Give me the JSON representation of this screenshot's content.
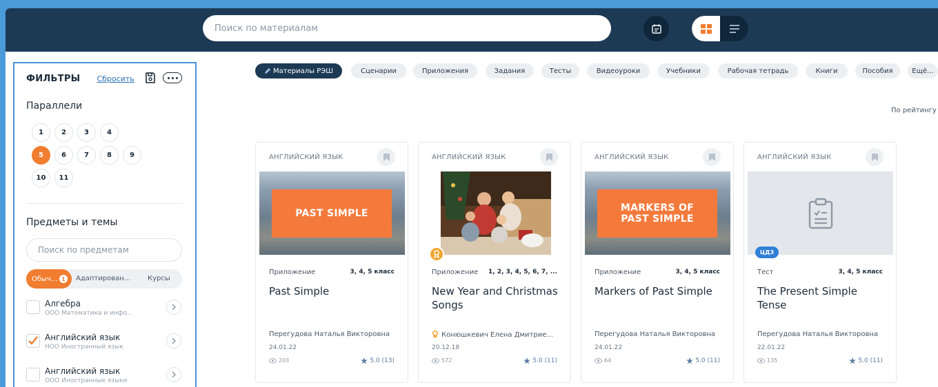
{
  "search": {
    "placeholder": "Поиск по материалам"
  },
  "icons": {
    "calendar": "calendar-icon",
    "grid_view": "grid-view-icon",
    "list_view": "list-view-icon",
    "save": "save-icon",
    "more": "more-icon",
    "bookmark": "bookmark-icon",
    "views": "views-icon",
    "star": "star-icon"
  },
  "colors": {
    "header": "#1d3a55",
    "accent": "#f07d30",
    "link": "#2a6fb3",
    "frame": "#4a9bd8"
  },
  "filters": {
    "title": "ФИЛЬТРЫ",
    "reset": "Сбросить",
    "grades_title": "Параллели",
    "grades": [
      "1",
      "2",
      "3",
      "4",
      "5",
      "6",
      "7",
      "8",
      "9",
      "10",
      "11"
    ],
    "selected_grade": "5",
    "subjects_title": "Предметы и темы",
    "subjects_search_placeholder": "Поиск по предметам",
    "tabs": {
      "regular": "Обыч...",
      "regular_count": "1",
      "adapted": "Адаптирован...",
      "courses": "Курсы"
    },
    "subjects": [
      {
        "name": "Алгебра",
        "sub": "ООО Математика и инфо...",
        "checked": false
      },
      {
        "name": "Английский язык",
        "sub": "НОО Иностранный язык",
        "checked": true
      },
      {
        "name": "Английский язык",
        "sub": "ООО Иностранные языки",
        "checked": false
      }
    ]
  },
  "chips": [
    "Материалы РЭШ",
    "Сценарии",
    "Приложения",
    "Задания",
    "Тесты",
    "Видеоуроки",
    "Учебники",
    "Рабочая тетрадь",
    "Книги",
    "Пособия",
    "Ещё..."
  ],
  "sort_label": "По рейтингу",
  "cards": [
    {
      "subject": "АНГЛИЙСКИЙ ЯЗЫК",
      "type": "Приложение",
      "grades": "3, 4, 5 класс",
      "title": "Past Simple",
      "banner": "PAST SIMPLE",
      "author": "Перегудова Наталья Викторовна",
      "date": "24.01.22",
      "views": "203",
      "rating": "5.0 (13)"
    },
    {
      "subject": "АНГЛИЙСКИЙ ЯЗЫК",
      "type": "Приложение",
      "grades": "1, 2, 3, 4, 5, 6, 7, ...",
      "title": "New Year and Christmas Songs",
      "author": "Конюшкевич Елена Дмитрие...",
      "date": "20.12.18",
      "views": "572",
      "rating": "5.0 (11)"
    },
    {
      "subject": "АНГЛИЙСКИЙ ЯЗЫК",
      "type": "Приложение",
      "grades": "3, 4, 5 класс",
      "title": "Markers of Past Simple",
      "banner": "MARKERS OF PAST SIMPLE",
      "author": "Перегудова Наталья Викторовна",
      "date": "24.01.22",
      "views": "64",
      "rating": "5.0 (11)"
    },
    {
      "subject": "АНГЛИЙСКИЙ ЯЗЫК",
      "type": "Тест",
      "grades": "3, 4, 5 класс",
      "title": "The Present Simple Tense",
      "badge": "ЦДЗ",
      "author": "Перегудова Наталья Викторовна",
      "date": "22.01.22",
      "views": "135",
      "rating": "5.0 (11)"
    }
  ]
}
